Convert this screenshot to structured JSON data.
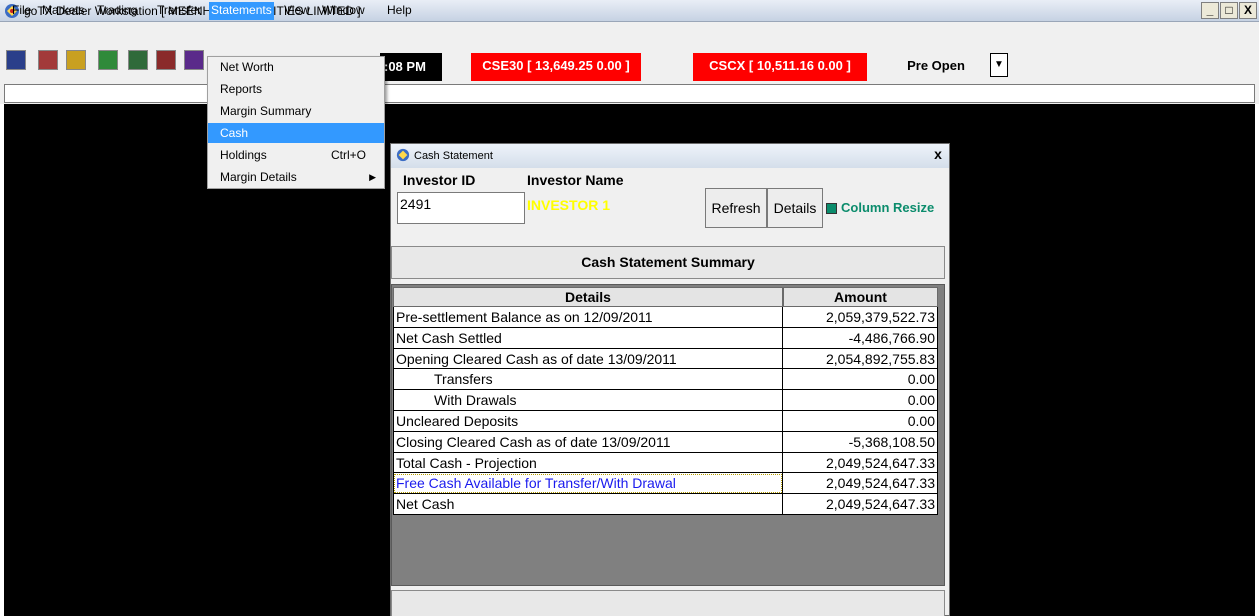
{
  "window": {
    "title": "goTX Dealer Workstation  [ MEENHAR SECURITIES LIMITED ]",
    "minimize": "_",
    "maximize": "□",
    "close": "X"
  },
  "menubar": [
    {
      "label": "File"
    },
    {
      "label": "Markets"
    },
    {
      "label": "Trading"
    },
    {
      "label": "Transfer"
    },
    {
      "label": "Statements"
    },
    {
      "label": "View"
    },
    {
      "label": "Window"
    },
    {
      "label": "Help"
    }
  ],
  "toolbar": {
    "clock": ":08 PM",
    "tickers": [
      {
        "text": "CSE30 [ 13,649.25  0.00 ]"
      },
      {
        "text": "CSCX [ 10,511.16  0.00 ]"
      }
    ],
    "market_status": "Pre Open",
    "dropdown_arrow": "▼"
  },
  "statements_menu": [
    {
      "label": "Net Worth",
      "shortcut": "",
      "submenu": false
    },
    {
      "label": "Reports",
      "shortcut": "",
      "submenu": false
    },
    {
      "label": "Margin Summary",
      "shortcut": "",
      "submenu": false
    },
    {
      "label": "Cash",
      "shortcut": "",
      "submenu": false
    },
    {
      "label": "Holdings",
      "shortcut": "Ctrl+O",
      "submenu": false
    },
    {
      "label": "Margin Details",
      "shortcut": "",
      "submenu": true
    }
  ],
  "statements_menu_arrow": "▶",
  "cash_statement": {
    "title": "Cash Statement",
    "close": "x",
    "investor_id_label": "Investor ID",
    "investor_name_label": "Investor Name",
    "investor_id_value": "2491",
    "investor_name_value": "INVESTOR 1",
    "refresh_label": "Refresh",
    "details_label": "Details",
    "column_resize_label": "Column Resize",
    "summary_title": "Cash Statement Summary",
    "table": {
      "headers": [
        "Details",
        "Amount"
      ],
      "rows": [
        {
          "details": "Pre-settlement Balance as on 12/09/2011",
          "amount": "2,059,379,522.73",
          "indent": false
        },
        {
          "details": "Net Cash Settled",
          "amount": "-4,486,766.90",
          "indent": false
        },
        {
          "details": "Opening Cleared Cash as of date 13/09/2011",
          "amount": "2,054,892,755.83",
          "indent": false
        },
        {
          "details": "Transfers",
          "amount": "0.00",
          "indent": true
        },
        {
          "details": "With Drawals",
          "amount": "0.00",
          "indent": true
        },
        {
          "details": "Uncleared Deposits",
          "amount": "0.00",
          "indent": false
        },
        {
          "details": "Closing Cleared Cash as of date 13/09/2011",
          "amount": "-5,368,108.50",
          "indent": false
        },
        {
          "details": "Total Cash - Projection",
          "amount": "2,049,524,647.33",
          "indent": false
        },
        {
          "details": "Free Cash Available for Transfer/With Drawal",
          "amount": "2,049,524,647.33",
          "indent": false,
          "highlight": true
        },
        {
          "details": "Net Cash",
          "amount": "2,049,524,647.33",
          "indent": false
        }
      ]
    }
  },
  "colors": {
    "menu_highlight": "#3399ff",
    "ticker_bg": "#ff0000",
    "investor_name": "#ffff00",
    "column_resize": "#0b8c6c"
  }
}
